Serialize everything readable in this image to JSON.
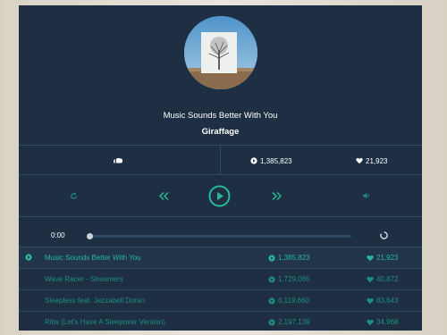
{
  "now_playing": {
    "title": "Music Sounds Better With You",
    "artist": "Giraffage",
    "plays": "1,385,823",
    "likes": "21,923"
  },
  "source_icon": "soundcloud-icon",
  "controls": {
    "repeat_icon": "repeat-icon",
    "previous_icon": "rewind-icon",
    "play_icon": "play-icon",
    "next_icon": "fast-forward-icon",
    "volume_icon": "volume-icon"
  },
  "progress": {
    "time": "0:00",
    "fraction": 0.0
  },
  "tracks": [
    {
      "title": "Music Sounds Better With You",
      "plays": "1,385,823",
      "likes": "21,923",
      "current": true
    },
    {
      "title": "Wave Racer - Streamers",
      "plays": "1,729,065",
      "likes": "40,872",
      "current": false
    },
    {
      "title": "Sleepless feat. Jezzabell Doran",
      "plays": "6,119,660",
      "likes": "83,643",
      "current": false
    },
    {
      "title": "Ribs (Let's Have A Sleepover Version)",
      "plays": "2,197,139",
      "likes": "34,968",
      "current": false
    }
  ],
  "colors": {
    "panel": "#1e2f43",
    "accent": "#26b99a",
    "divider": "#2f4d60"
  }
}
